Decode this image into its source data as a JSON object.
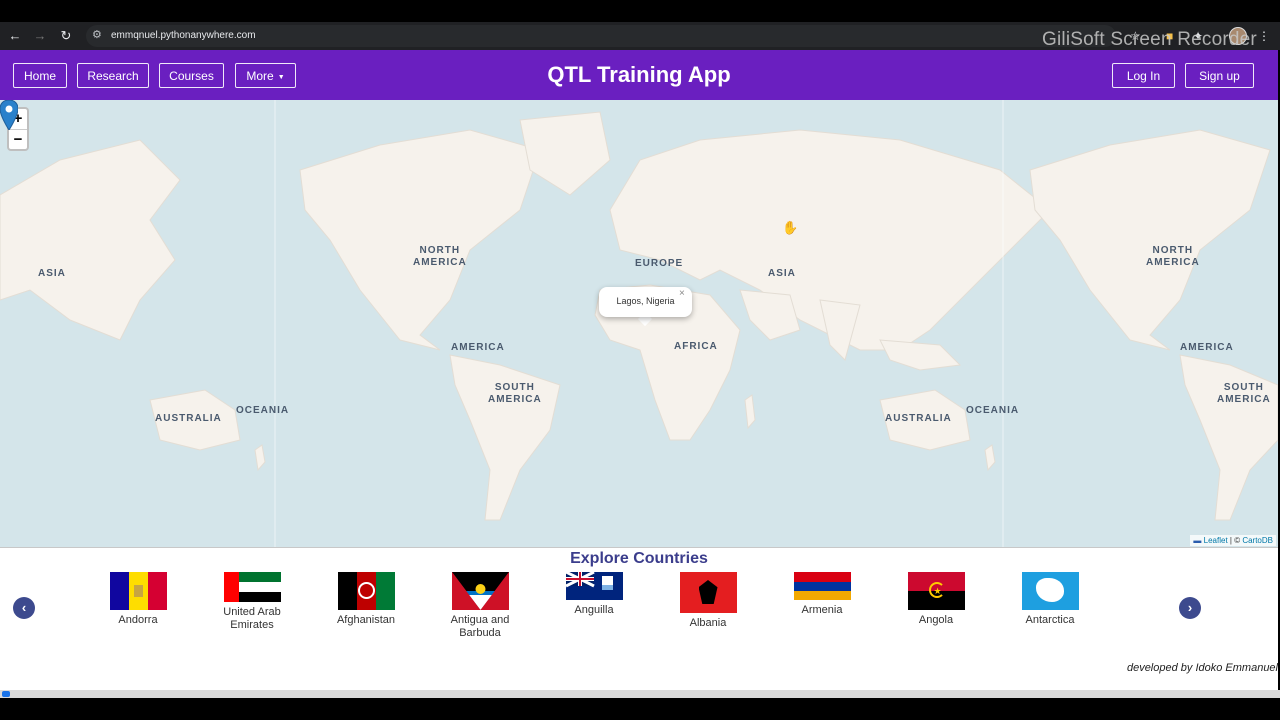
{
  "browser": {
    "url": "emmqnuel.pythonanywhere.com",
    "watermark": "GiliSoft Screen Recorder"
  },
  "navbar": {
    "title": "QTL Training App",
    "left_items": [
      "Home",
      "Research",
      "Courses",
      "More"
    ],
    "right_items": [
      "Log In",
      "Sign up"
    ]
  },
  "map": {
    "zoom_in": "+",
    "zoom_out": "−",
    "labels": {
      "asia_left": "ASIA",
      "north_america": "NORTH\nAMERICA",
      "europe": "EUROPE",
      "asia": "ASIA",
      "north_america_right": "NORTH\nAMERICA",
      "america": "AMERICA",
      "africa": "AFRICA",
      "america_right": "AMERICA",
      "south_america": "SOUTH\nAMERICA",
      "south_america_right": "SOUTH\nAMERICA",
      "australia": "AUSTRALIA",
      "oceania": "OCEANIA",
      "australia_right": "AUSTRALIA",
      "oceania_right": "OCEANIA"
    },
    "popup_text": "Lagos, Nigeria",
    "popup_close": "×",
    "attribution_leaflet": "Leaflet",
    "attribution_sep": " | © ",
    "attribution_carto": "CartoDB"
  },
  "explore": {
    "title": "Explore Countries",
    "prev": "‹",
    "next": "›",
    "countries": [
      {
        "name": "Andorra"
      },
      {
        "name": "United Arab Emirates"
      },
      {
        "name": "Afghanistan"
      },
      {
        "name": "Antigua and Barbuda"
      },
      {
        "name": "Anguilla"
      },
      {
        "name": "Albania"
      },
      {
        "name": "Armenia"
      },
      {
        "name": "Angola"
      },
      {
        "name": "Antarctica"
      }
    ],
    "credit": "developed by Idoko Emmanuel"
  },
  "colors": {
    "navbar": "#6a1fc0",
    "ocean": "#d4e5ea",
    "land": "#f6f2ec",
    "marker": "#2a81cb",
    "explore_title": "#3b3d8c"
  }
}
